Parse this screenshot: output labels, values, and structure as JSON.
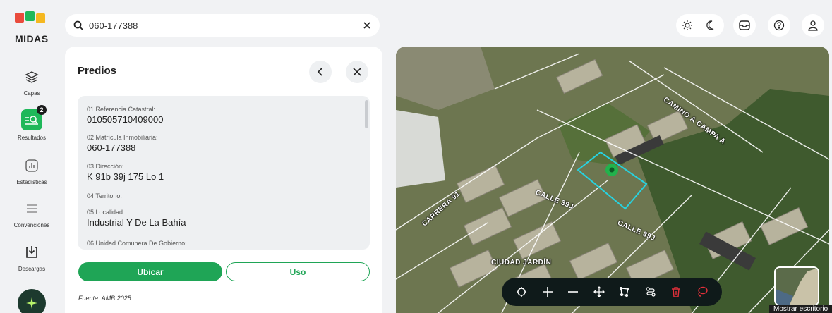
{
  "app": {
    "logo_text": "MIDAS"
  },
  "sidebar": {
    "items": [
      {
        "label": "Capas",
        "icon": "layers-icon"
      },
      {
        "label": "Resultados",
        "icon": "search-results-icon",
        "badge": "2"
      },
      {
        "label": "Estadísticas",
        "icon": "bar-chart-icon"
      },
      {
        "label": "Convenciones",
        "icon": "list-icon"
      },
      {
        "label": "Descargas",
        "icon": "download-icon"
      }
    ]
  },
  "search": {
    "value": "060-177388"
  },
  "panel": {
    "title": "Predios",
    "fields": [
      {
        "label": "01 Referencia Catastral:",
        "value": "010505710409000"
      },
      {
        "label": "02 Matrícula Inmobiliaria:",
        "value": "060-177388"
      },
      {
        "label": "03 Dirección:",
        "value": "K 91b 39j 175 Lo 1"
      },
      {
        "label": "04 Territorio:",
        "value": ""
      },
      {
        "label": "05 Localidad:",
        "value": "Industrial Y De La Bahía"
      },
      {
        "label": "06 Unidad Comunera De Gobierno:",
        "value": ""
      }
    ],
    "ubicar_label": "Ubicar",
    "uso_label": "Uso",
    "source": "Fuente: AMB 2025"
  },
  "map": {
    "streets": [
      "CAMINO A CAMPA A",
      "CARRERA 91",
      "CALLE 39J",
      "CALLE 39J",
      "CIUDAD JARDÍN"
    ],
    "tooltip": "Mostrar escritorio"
  },
  "colors": {
    "accent": "#1fa556",
    "parcel": "#27d3e0",
    "toolbar": "#0f1a1a",
    "danger": "#e0303a"
  }
}
